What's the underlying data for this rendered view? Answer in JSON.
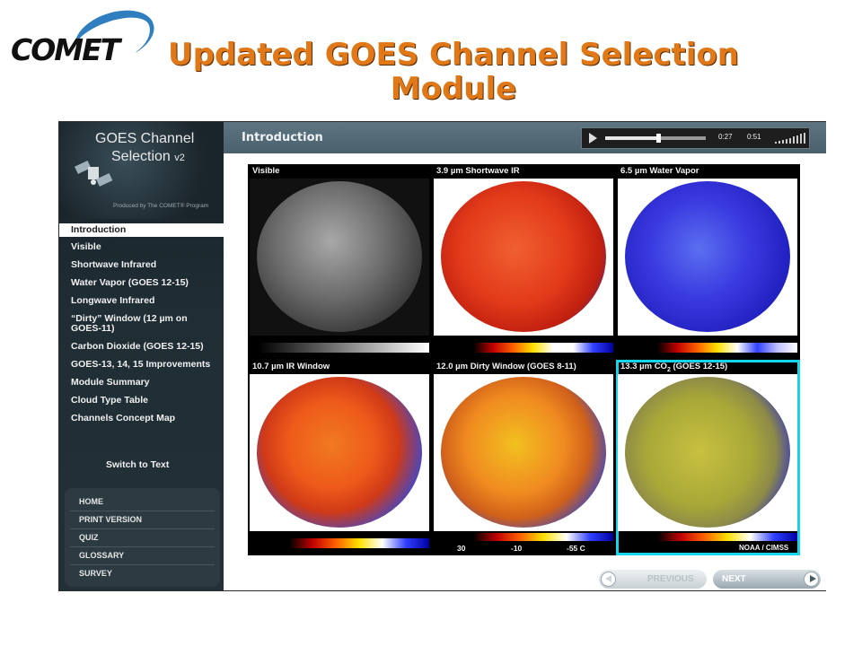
{
  "logo": {
    "text": "COMET"
  },
  "slide": {
    "title": "Updated GOES Channel Selection Module"
  },
  "sidebar": {
    "title_line1": "GOES Channel",
    "title_line2": "Selection",
    "version": "v2",
    "produced_by": "Produced by The COMET® Program",
    "items": [
      {
        "label": "Introduction",
        "active": true
      },
      {
        "label": "Visible"
      },
      {
        "label": "Shortwave Infrared"
      },
      {
        "label": "Water Vapor (GOES 12-15)"
      },
      {
        "label": "Longwave Infrared"
      },
      {
        "label": "“Dirty” Window (12 µm on GOES-11)"
      },
      {
        "label": "Carbon Dioxide (GOES 12-15)"
      },
      {
        "label": "GOES-13, 14, 15 Improvements"
      },
      {
        "label": "Module Summary"
      },
      {
        "label": "Cloud Type Table"
      },
      {
        "label": "Channels Concept Map"
      }
    ],
    "switch_to_text": "Switch to Text",
    "bottom_links": [
      "HOME",
      "PRINT VERSION",
      "QUIZ",
      "GLOSSARY",
      "SURVEY"
    ]
  },
  "header": {
    "title": "Introduction",
    "player": {
      "current_time": "0:27",
      "total_time": "0:51",
      "progress": 0.53
    }
  },
  "panels": [
    {
      "title": "Visible",
      "icon": "globe-visible-image"
    },
    {
      "title": "3.9 µm Shortwave IR",
      "icon": "globe-shortwave-ir-image"
    },
    {
      "title": "6.5 µm Water Vapor",
      "icon": "globe-water-vapor-image"
    },
    {
      "title": "10.7 µm IR Window",
      "icon": "globe-ir-window-image"
    },
    {
      "title": "12.0 µm Dirty Window (GOES 8-11)",
      "icon": "globe-dirty-window-image"
    },
    {
      "title_prefix": "13.3 µm CO",
      "title_sub": "2",
      "title_suffix": " (GOES 12-15)",
      "icon": "globe-co2-image",
      "highlighted": true
    }
  ],
  "scale_labels": [
    "30",
    "-10",
    "-55 C"
  ],
  "credit": "NOAA / CIMSS",
  "navigation": {
    "previous_label": "PREVIOUS",
    "next_label": "NEXT"
  },
  "colors": {
    "title_orange": "#e07818",
    "highlight_cyan": "#18d4e8",
    "sidebar_bg": "#1f2d34",
    "header_bg": "#536a77"
  }
}
